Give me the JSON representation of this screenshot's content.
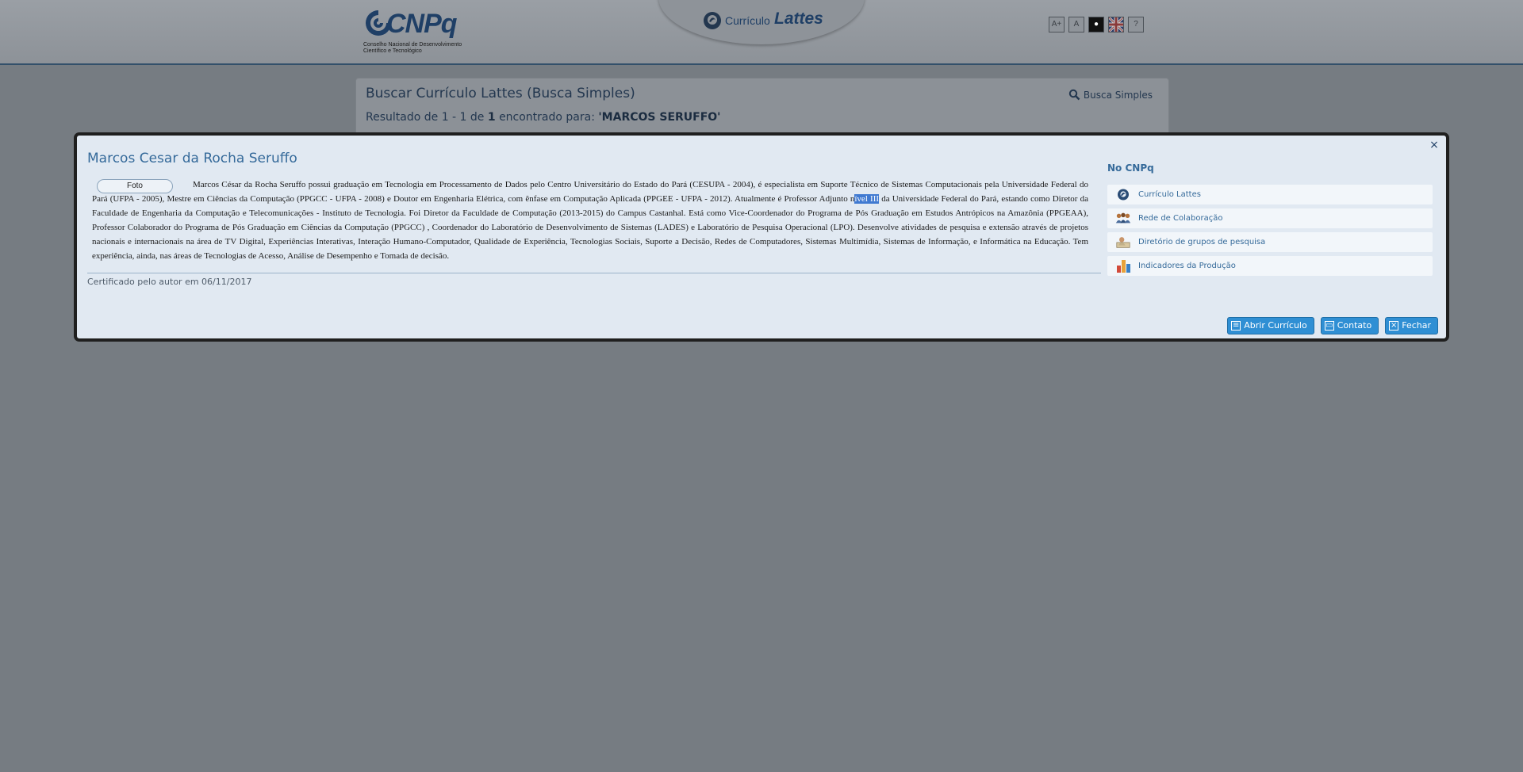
{
  "header": {
    "logo_text": "CNPq",
    "logo_subtitle_line1": "Conselho Nacional de Desenvolvimento",
    "logo_subtitle_line2": "Científico e Tecnológico",
    "center_logo_word1": "Currículo",
    "center_logo_word2": "Lattes",
    "tools": {
      "increase_font": "A+",
      "decrease_font": "A",
      "contrast": "●",
      "help": "?"
    }
  },
  "search_panel": {
    "title": "Buscar Currículo Lattes (Busca Simples)",
    "mode_link": "Busca Simples",
    "result_prefix": "Resultado de 1 - 1 de",
    "result_count": "1",
    "result_middle": "encontrado para:",
    "result_query": "'MARCOS SERUFFO'"
  },
  "modal": {
    "close_symbol": "×",
    "title": "Marcos Cesar da Rocha Seruffo",
    "photo_label": "Foto",
    "bio_part1": "Marcos César da Rocha Seruffo possui graduação em Tecnologia em Processamento de Dados pelo Centro Universitário do Estado do Pará (CESUPA - 2004), é especialista em Suporte Técnico de Sistemas Computacionais pela Universidade Federal do Pará (UFPA - 2005), Mestre em Ciências da Computação (PPGCC - UFPA - 2008) e Doutor em Engenharia Elétrica, com ênfase em Computação Aplicada (PPGEE - UFPA - 2012). Atualmente é Professor Adjunto n",
    "bio_selected": "ível III",
    "bio_part2": " da Universidade Federal do Pará, estando como Diretor da Faculdade de Engenharia da Computação e Telecomunicações - Instituto de Tecnologia. Foi Diretor da Faculdade de Computação (2013-2015) do Campus Castanhal. Está como Vice-Coordenador do Programa de Pós Graduação em Estudos Antrópicos na Amazônia (PPGEAA), Professor Colaborador do Programa de Pós Graduação em Ciências da Computação (PPGCC) , Coordenador do Laboratório de Desenvolvimento de Sistemas (LADES) e Laboratório de Pesquisa Operacional (LPO). Desenvolve atividades de pesquisa e extensão através de projetos nacionais e internacionais na área de TV Digital, Experiências Interativas, Interação Humano-Computador, Qualidade de Experiência, Tecnologias Sociais, Suporte a Decisão, Redes de Computadores, Sistemas Multimídia, Sistemas de Informação, e Informática na Educação. Tem experiência, ainda, nas áreas de Tecnologias de Acesso, Análise de Desempenho e Tomada de decisão.",
    "certified": "Certificado pelo autor em 06/11/2017",
    "sidebar": {
      "title": "No CNPq",
      "items": [
        {
          "label": "Currículo Lattes",
          "icon": "lattes-icon"
        },
        {
          "label": "Rede de Colaboração",
          "icon": "people-icon"
        },
        {
          "label": "Diretório de grupos de pesquisa",
          "icon": "directory-icon"
        },
        {
          "label": "Indicadores da Produção",
          "icon": "bar-chart-icon"
        }
      ]
    },
    "buttons": {
      "open_cv": "Abrir Currículo",
      "contact": "Contato",
      "close": "Fechar"
    }
  },
  "colors": {
    "overlay_background": "#767c82",
    "modal_background": "#e1e9f2",
    "title_blue": "#356a9a",
    "button_blue": "#2f8fd4",
    "selection": "#3f79d1"
  }
}
